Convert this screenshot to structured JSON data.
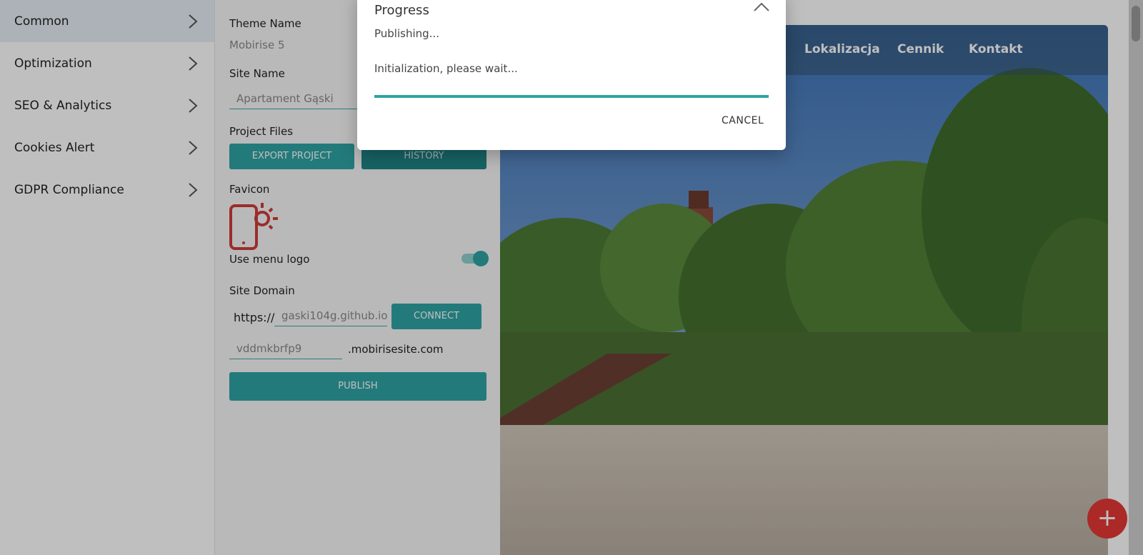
{
  "nav": {
    "items": [
      {
        "label": "Common"
      },
      {
        "label": "Optimization"
      },
      {
        "label": "SEO & Analytics"
      },
      {
        "label": "Cookies Alert"
      },
      {
        "label": "GDPR Compliance"
      }
    ]
  },
  "settings": {
    "theme_name_label": "Theme Name",
    "theme_name_value": "Mobirise 5",
    "site_name_label": "Site Name",
    "site_name_value": "Apartament Gąski",
    "project_files_label": "Project Files",
    "export_button": "EXPORT PROJECT",
    "history_button": "HISTORY",
    "favicon_label": "Favicon",
    "use_menu_logo_label": "Use menu logo",
    "use_menu_logo_on": true,
    "site_domain_label": "Site Domain",
    "domain_prefix": "https://",
    "domain_value": "gaski104g.github.io",
    "connect_button": "CONNECT",
    "subdomain_value": "vddmkbrfp9",
    "subdomain_suffix": ".mobirisesite.com",
    "publish_button": "PUBLISH"
  },
  "preview": {
    "menu_items": [
      "Lokalizacja",
      "Cennik",
      "Kontakt"
    ]
  },
  "fab": {
    "label": "+"
  },
  "modal": {
    "title": "Progress",
    "status": "Publishing...",
    "detail": "Initialization, please wait...",
    "cancel": "CANCEL",
    "progress": 1.0
  },
  "colors": {
    "accent": "#2fa3a4",
    "fab": "#e53935",
    "favicon": "#d13b3b"
  },
  "icons": [
    "chevron-right-icon",
    "close-icon",
    "favicon-phone-sun-icon",
    "plus-icon"
  ]
}
